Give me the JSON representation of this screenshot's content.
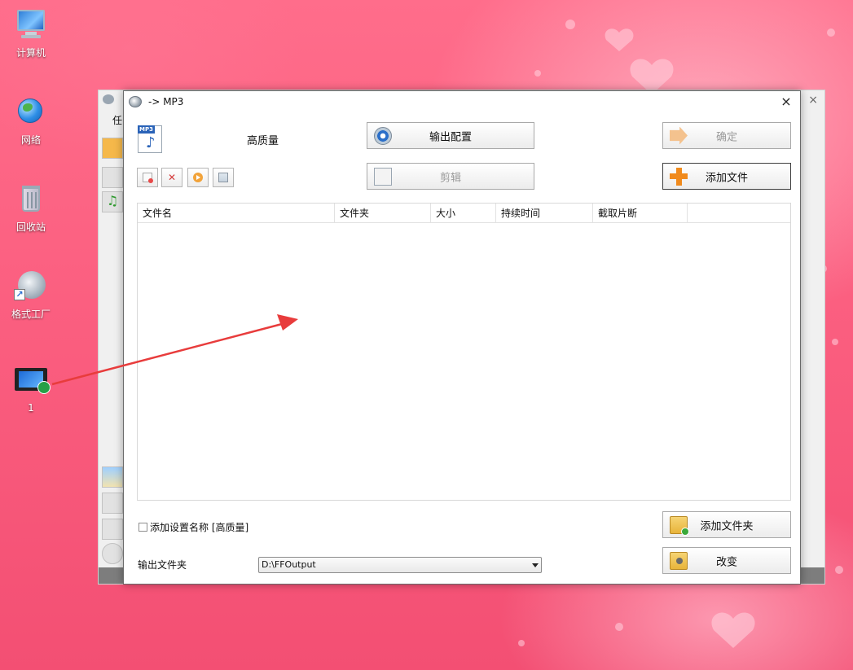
{
  "desktop": {
    "icons": [
      {
        "label": "计算机",
        "icon": "computer-icon"
      },
      {
        "label": "网络",
        "icon": "network-icon"
      },
      {
        "label": "回收站",
        "icon": "recycle-bin-icon"
      },
      {
        "label": "格式工厂",
        "icon": "format-factory-icon"
      },
      {
        "label": "1",
        "icon": "video-file-icon"
      }
    ]
  },
  "background_window": {
    "partial_label": "任"
  },
  "dialog": {
    "title": "-> MP3",
    "close_label": "×",
    "profile_label": "高质量",
    "buttons": {
      "output_config": "输出配置",
      "confirm": "确定",
      "clip": "剪辑",
      "add_file": "添加文件",
      "add_folder": "添加文件夹",
      "change": "改变"
    },
    "table": {
      "columns": [
        "文件名",
        "文件夹",
        "大小",
        "持续时间",
        "截取片断"
      ],
      "rows": []
    },
    "checkbox_label": "添加设置名称 [高质量]",
    "output_folder_label": "输出文件夹",
    "output_folder_value": "D:\\FFOutput"
  },
  "colors": {
    "annotation_arrow": "#e83c3c",
    "desktop_pink": "#fb5f80",
    "plus_orange": "#f08a1c"
  }
}
